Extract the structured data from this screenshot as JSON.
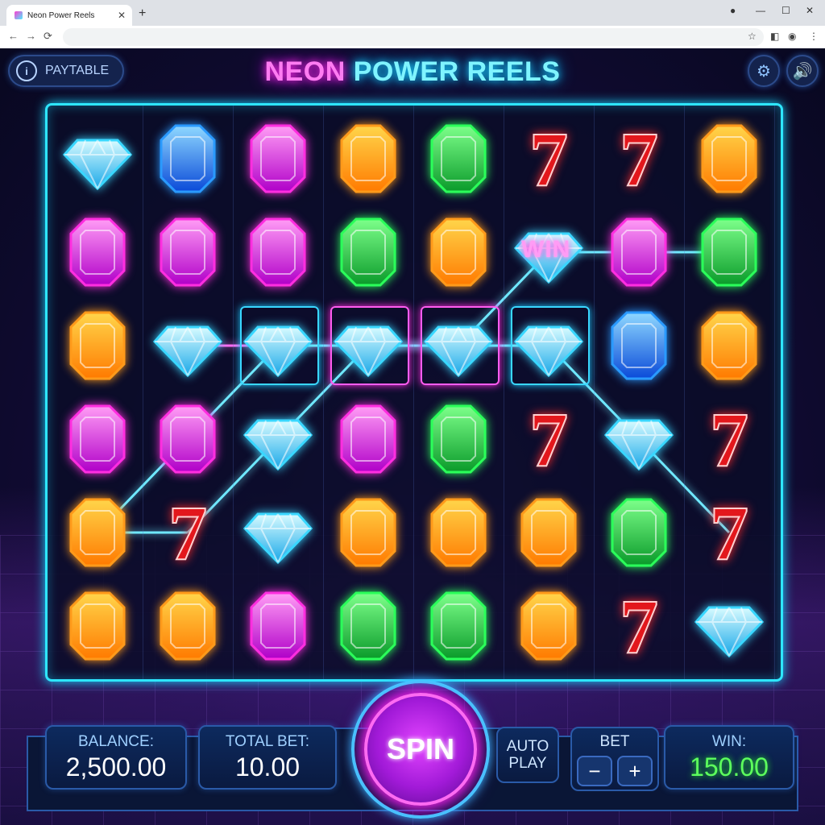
{
  "browser": {
    "tab_title": "Neon Power Reels",
    "tab_close": "✕",
    "new_tab": "+",
    "back": "←",
    "forward": "→",
    "reload": "⟳",
    "star": "☆",
    "menu": "⋮"
  },
  "header": {
    "paytable_label": "PAYTABLE",
    "info_glyph": "i",
    "title_part1": "NEON",
    "title_part2": "POWER REELS",
    "settings_icon": "gear-icon",
    "sound_icon": "speaker-icon"
  },
  "reels": {
    "columns": 8,
    "rows": 6,
    "grid": [
      [
        "diamond",
        "sapphire",
        "amethyst",
        "topaz",
        "emerald",
        "seven",
        "seven",
        "topaz"
      ],
      [
        "amethyst",
        "amethyst",
        "amethyst",
        "emerald",
        "topaz",
        "diamond",
        "amethyst",
        "emerald"
      ],
      [
        "topaz",
        "diamond",
        "diamond",
        "diamond",
        "diamond",
        "diamond",
        "sapphire",
        "topaz"
      ],
      [
        "amethyst",
        "amethyst",
        "diamond",
        "amethyst",
        "emerald",
        "seven",
        "diamond",
        "seven"
      ],
      [
        "topaz",
        "seven",
        "diamond",
        "topaz",
        "topaz",
        "topaz",
        "emerald",
        "seven"
      ],
      [
        "topaz",
        "topaz",
        "amethyst",
        "emerald",
        "emerald",
        "topaz",
        "seven",
        "diamond"
      ]
    ],
    "highlights": [
      {
        "row": 2,
        "col": 2,
        "color": "blue"
      },
      {
        "row": 2,
        "col": 3,
        "color": "pink"
      },
      {
        "row": 2,
        "col": 4,
        "color": "pink"
      },
      {
        "row": 2,
        "col": 5,
        "color": "blue"
      }
    ],
    "win_badge": {
      "text": "WIN",
      "row": 1,
      "col": 5
    },
    "colors": {
      "frame": "#2ee6ff",
      "payline_blue": "#6fe8ff",
      "payline_pink": "#ff6af2"
    }
  },
  "console": {
    "balance_label": "BALANCE:",
    "balance_value": "2,500.00",
    "total_bet_label": "TOTAL BET:",
    "total_bet_value": "10.00",
    "spin_label": "SPIN",
    "autoplay_line1": "AUTO",
    "autoplay_line2": "PLAY",
    "bet_label": "BET",
    "bet_minus": "−",
    "bet_plus": "+",
    "win_label": "WIN:",
    "win_value": "150.00"
  }
}
